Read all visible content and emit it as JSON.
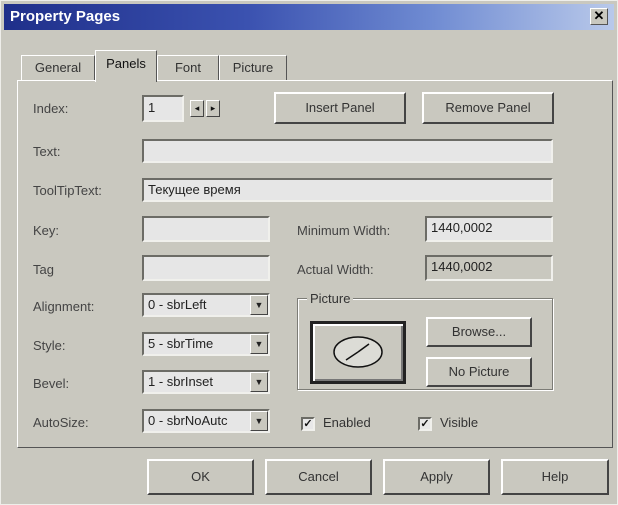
{
  "window": {
    "title": "Property Pages",
    "close_glyph": "✕"
  },
  "tabs": [
    {
      "label": "General"
    },
    {
      "label": "Panels",
      "active": true
    },
    {
      "label": "Font"
    },
    {
      "label": "Picture"
    }
  ],
  "index": {
    "label": "Index:",
    "value": "1",
    "prev_glyph": "◂",
    "next_glyph": "▸"
  },
  "buttons": {
    "insert_panel": "Insert Panel",
    "remove_panel": "Remove Panel",
    "browse": "Browse...",
    "no_picture": "No Picture",
    "ok": "OK",
    "cancel": "Cancel",
    "apply": "Apply",
    "help": "Help"
  },
  "fields": {
    "text": {
      "label": "Text:",
      "value": ""
    },
    "tooltip": {
      "label": "ToolTipText:",
      "value": "Текущее время"
    },
    "key": {
      "label": "Key:",
      "value": ""
    },
    "tag": {
      "label": "Tag",
      "value": ""
    },
    "min_width": {
      "label": "Minimum Width:",
      "value": "1440,0002"
    },
    "actual_width": {
      "label": "Actual Width:",
      "value": "1440,0002"
    }
  },
  "combos": {
    "alignment": {
      "label": "Alignment:",
      "value": "0 - sbrLeft"
    },
    "style": {
      "label": "Style:",
      "value": "5 - sbrTime"
    },
    "bevel": {
      "label": "Bevel:",
      "value": "1 - sbrInset"
    },
    "autosize": {
      "label": "AutoSize:",
      "value": "0 - sbrNoAutc"
    }
  },
  "combo_arrow": "▼",
  "picture_group": {
    "label": "Picture",
    "icon": "clock-icon"
  },
  "checkboxes": {
    "enabled": {
      "label": "Enabled",
      "checked": true,
      "mark": "✓"
    },
    "visible": {
      "label": "Visible",
      "checked": true,
      "mark": "✓"
    }
  },
  "colors": {
    "title_start": "#1f2f8a",
    "title_end": "#b9c9ea",
    "face": "#c9c8bf"
  }
}
